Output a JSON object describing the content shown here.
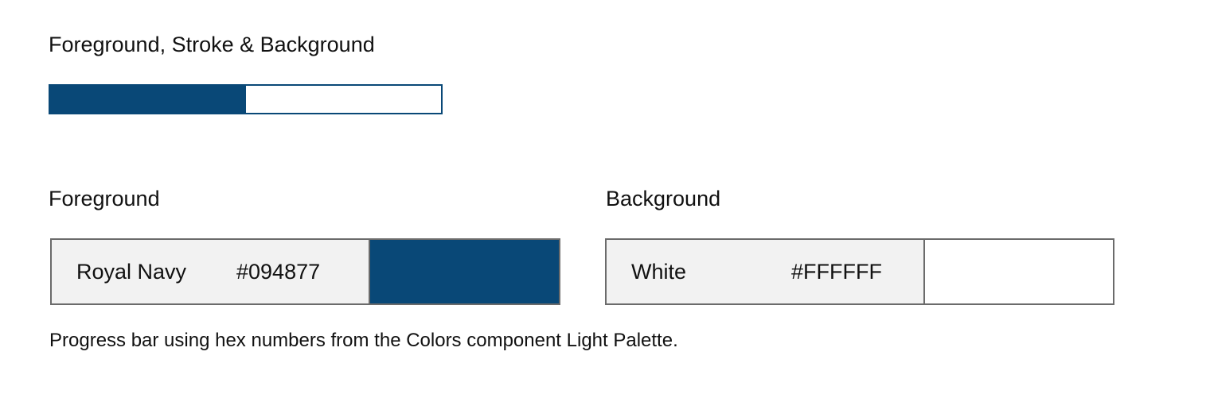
{
  "headings": {
    "main": "Foreground, Stroke & Background",
    "foreground": "Foreground",
    "background": "Background"
  },
  "progress": {
    "value_fraction": 0.5,
    "foreground_color": "#094877",
    "stroke_color": "#094877",
    "background_color": "#FFFFFF"
  },
  "swatches": {
    "foreground": {
      "name": "Royal Navy",
      "hex": "#094877"
    },
    "background": {
      "name": "White",
      "hex": "#FFFFFF"
    }
  },
  "caption": "Progress bar using hex numbers from the Colors component Light Palette."
}
